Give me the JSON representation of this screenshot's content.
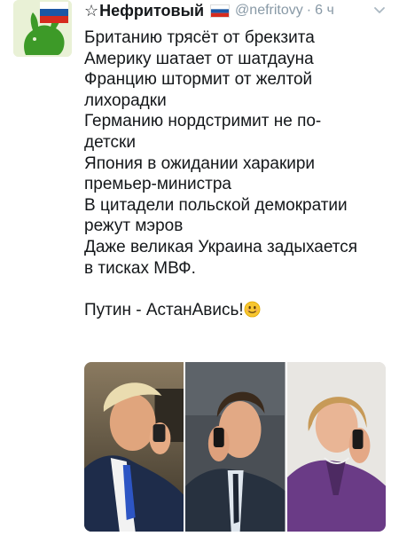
{
  "tweet": {
    "author": {
      "star": "☆",
      "display_name": "Нефритовый",
      "handle": "@nefritovy",
      "flag_icon": "russia-flag-icon",
      "avatar_icon": "green-rabbit-avatar"
    },
    "separator": "·",
    "timestamp": "6 ч",
    "menu_icon": "chevron-down-icon",
    "lines": [
      "Британию трясёт от брекзита",
      "Америку шатает от шатдауна",
      "Францию штормит от желтой",
      "лихорадки",
      "Германию нордстримит не по-",
      "детски",
      "Япония в ожидании харакири",
      "премьер-министра",
      "В цитадели польской демократии",
      "режут мэров",
      "Даже великая Украина задыхается",
      "в тисках МВФ."
    ],
    "closing_line": "Путин - АстанАвись!",
    "closing_emoji": "smiling-face-emoji",
    "media": {
      "photos": [
        "phone-call-photo-1",
        "phone-call-photo-2",
        "phone-call-photo-3"
      ]
    }
  },
  "colors": {
    "text": "#14171a",
    "secondary_text": "#8899a6",
    "avatar_bg": "#e9f1d6",
    "rabbit_green": "#3d9a28"
  }
}
